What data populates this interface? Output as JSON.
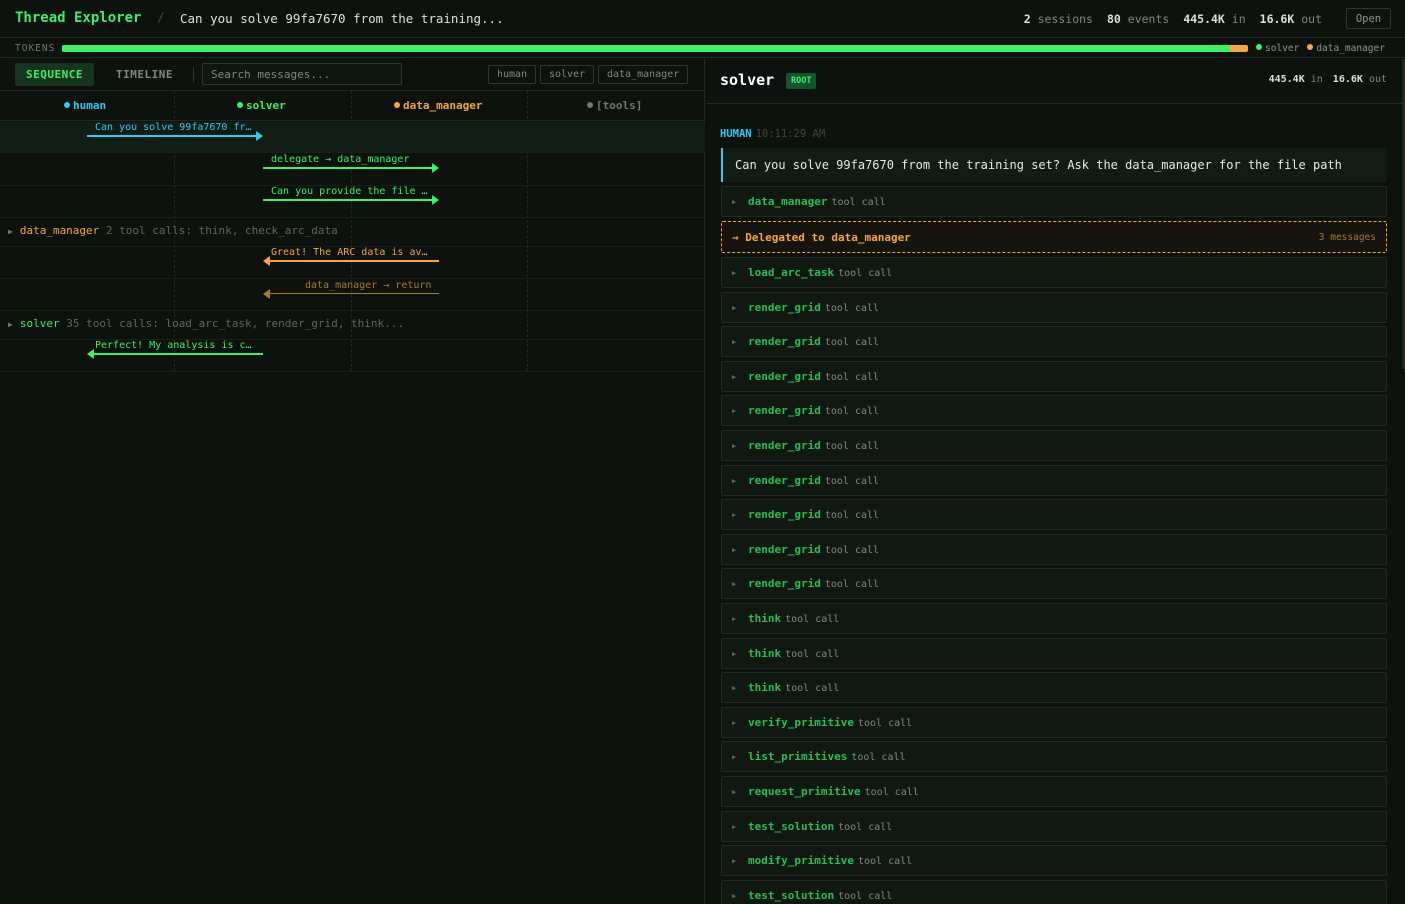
{
  "header": {
    "app_title": "Thread Explorer",
    "separator": "/",
    "thread_title": "Can you solve 99fa7670 from the training...",
    "stats": {
      "sessions_value": "2",
      "sessions_label": "sessions",
      "events_value": "80",
      "events_label": "events",
      "in_value": "445.4K",
      "in_label": "in",
      "out_value": "16.6K",
      "out_label": "out"
    },
    "open_button": "Open"
  },
  "tokens": {
    "label": "TOKENS",
    "solver_fraction": 0.985,
    "data_manager_fraction": 0.015,
    "legend": [
      {
        "name": "solver",
        "color": "#3cf06a"
      },
      {
        "name": "data_manager",
        "color": "#f5a742"
      }
    ]
  },
  "left": {
    "tabs": [
      {
        "label": "SEQUENCE",
        "active": true
      },
      {
        "label": "TIMELINE",
        "active": false
      }
    ],
    "search_placeholder": "Search messages...",
    "filters": [
      "human",
      "solver",
      "data_manager"
    ],
    "lanes": [
      {
        "name": "human",
        "color": "#35c8f5"
      },
      {
        "name": "solver",
        "color": "#3cf06a"
      },
      {
        "name": "data_manager",
        "color": "#f5a742"
      },
      {
        "name": "[tools]",
        "color": "#6c7a6e"
      }
    ],
    "messages": [
      {
        "text": "Can you solve 99fa7670 fr…",
        "color": "#35c8f5"
      },
      {
        "text": "delegate → data_manager",
        "color": "#3cf06a"
      },
      {
        "text": "Can you provide the file …",
        "color": "#3cf06a"
      },
      {
        "text": "Great! The ARC data is av…",
        "color": "#f5a742"
      },
      {
        "text": "data_manager → return",
        "color": "#a3783a"
      },
      {
        "text": "Perfect! My analysis is c…",
        "color": "#3cf06a"
      }
    ],
    "groups": [
      {
        "agent": "data_manager",
        "summary": "2 tool calls: think, check_arc_data",
        "color": "#f5a742"
      },
      {
        "agent": "solver",
        "summary": "35 tool calls: load_arc_task, render_grid, think...",
        "color": "#3cf06a"
      }
    ]
  },
  "right": {
    "agent_name": "solver",
    "badge": "ROOT",
    "in_value": "445.4K",
    "in_label": "in",
    "out_value": "16.6K",
    "out_label": "out",
    "sender": "HUMAN",
    "timestamp": "10:11:29 AM",
    "human_message": "Can you solve 99fa7670 from the training set? Ask the data_manager for the file path",
    "tool_call_label": "tool call",
    "delegation": {
      "text": "→ Delegated to data_manager",
      "count": "3 messages"
    },
    "tool_calls_before": [
      "data_manager"
    ],
    "tool_calls_after": [
      "load_arc_task",
      "render_grid",
      "render_grid",
      "render_grid",
      "render_grid",
      "render_grid",
      "render_grid",
      "render_grid",
      "render_grid",
      "render_grid",
      "think",
      "think",
      "think",
      "verify_primitive",
      "list_primitives",
      "request_primitive",
      "test_solution",
      "modify_primitive",
      "test_solution"
    ]
  }
}
